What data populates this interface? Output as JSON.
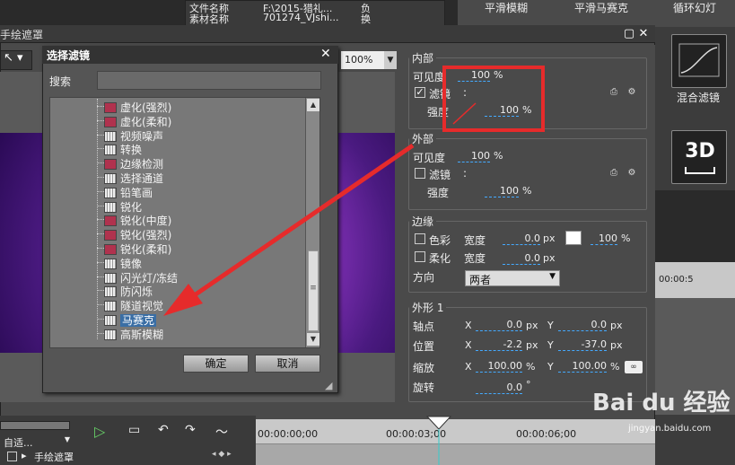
{
  "top": {
    "file_rows": [
      {
        "label": "文件名称",
        "value": "F:\\2015-猎礼..."
      },
      {
        "label": "素材名称",
        "value": "701274_VJshi..."
      }
    ],
    "right_snippets": [
      "负",
      "换"
    ],
    "tabs": [
      "平滑模糊",
      "平滑马赛克",
      "循环幻灯"
    ]
  },
  "window": {
    "title": "手绘遮罩"
  },
  "toolbar": {
    "zoom": "100%"
  },
  "dialog": {
    "title": "选择滤镜",
    "search_label": "搜索",
    "search_value": "",
    "items": [
      {
        "label": "虚化(强烈)",
        "red": true
      },
      {
        "label": "虚化(柔和)",
        "red": true
      },
      {
        "label": "视频噪声",
        "red": false
      },
      {
        "label": "转换",
        "red": false
      },
      {
        "label": "边缘检测",
        "red": true
      },
      {
        "label": "选择通道",
        "red": false
      },
      {
        "label": "铅笔画",
        "red": false
      },
      {
        "label": "锐化",
        "red": false
      },
      {
        "label": "锐化(中度)",
        "red": true
      },
      {
        "label": "锐化(强烈)",
        "red": true
      },
      {
        "label": "锐化(柔和)",
        "red": true
      },
      {
        "label": "镜像",
        "red": false
      },
      {
        "label": "闪光灯/冻结",
        "red": false
      },
      {
        "label": "防闪烁",
        "red": false
      },
      {
        "label": "隧道视觉",
        "red": false
      },
      {
        "label": "马赛克",
        "red": false,
        "selected": true
      },
      {
        "label": "高斯模糊",
        "red": false
      }
    ],
    "ok_label": "确定",
    "cancel_label": "取消"
  },
  "inner": {
    "title": "内部",
    "visibility_label": "可见度",
    "visibility_value": "100",
    "visibility_unit": "%",
    "filter_label": "滤镜",
    "filter_checked": true,
    "filter_colon": ":",
    "strength_label": "强度",
    "strength_value": "100",
    "strength_unit": "%"
  },
  "outer": {
    "title": "外部",
    "visibility_label": "可见度",
    "visibility_value": "100",
    "visibility_unit": "%",
    "filter_label": "滤镜",
    "filter_checked": false,
    "filter_colon": ":",
    "strength_label": "强度",
    "strength_value": "100",
    "strength_unit": "%"
  },
  "edge": {
    "title": "边缘",
    "color_label": "色彩",
    "color_width_label": "宽度",
    "color_width_value": "0.0",
    "color_width_unit": "px",
    "color_pct": "100",
    "color_pct_unit": "%",
    "soft_label": "柔化",
    "soft_width_label": "宽度",
    "soft_width_value": "0.0",
    "soft_width_unit": "px",
    "direction_label": "方向",
    "direction_value": "两者"
  },
  "shape": {
    "title": "外形 1",
    "pivot_label": "轴点",
    "pivot_x": "0.0",
    "pivot_y": "0.0",
    "position_label": "位置",
    "position_x": "-2.2",
    "position_y": "-37.0",
    "scale_label": "缩放",
    "scale_x": "100.00",
    "scale_y": "100.00",
    "rotate_label": "旋转",
    "rotate_value": "0.0",
    "rotate_unit": "°",
    "x_label": "X",
    "y_label": "Y",
    "px": "px",
    "pct": "%"
  },
  "side": {
    "blend_label": "混合滤镜",
    "threed_label": "3D"
  },
  "timeline": {
    "mode": "自适...",
    "track_label": "手绘遮罩",
    "times": [
      "00:00:00;00",
      "00:00:03;00",
      "00:00:06;00"
    ],
    "right_time": "00:00:5"
  },
  "watermark": {
    "logo": "Bai du 经验",
    "url": "jingyan.baidu.com"
  },
  "colors": {
    "highlight": "#e62b2b",
    "arrow": "#e62b2b",
    "selection": "#3a6ea5"
  }
}
